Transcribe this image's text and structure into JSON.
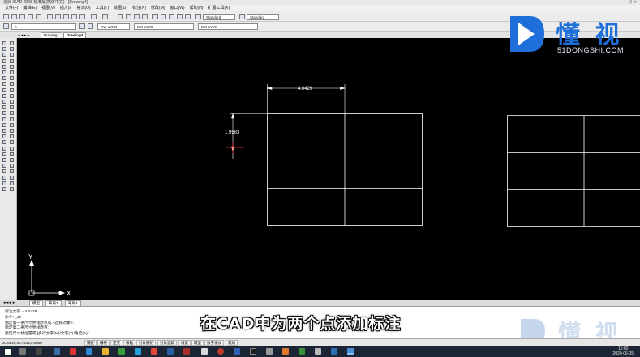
{
  "window": {
    "title": "浩辰 ICAD 2008 标准版(简体中文) - [Drawing4]",
    "controls": "—  ☐  ✕"
  },
  "menubar": {
    "items": [
      "文件(F)",
      "编辑(E)",
      "视图(V)",
      "插入(I)",
      "格式(O)",
      "工具(T)",
      "绘图(D)",
      "标注(N)",
      "修改(M)",
      "窗口(W)",
      "帮助(H)",
      "扩展工具(X)"
    ]
  },
  "toolbar": {
    "text_style": "Standard",
    "dim_style": "Standard",
    "layer": "0",
    "color": "BYLAYER",
    "linetype": "BYLAYER",
    "lineweight": "BYLAYER"
  },
  "tabs": {
    "drawings": [
      "Drawing1",
      "Drawing4"
    ],
    "layouts": [
      "模型",
      "布局1",
      "布局2"
    ]
  },
  "canvas": {
    "dimension_horizontal": "4.0429",
    "dimension_vertical": "1.9583",
    "ucs_x": "X",
    "ucs_y": "Y"
  },
  "command": {
    "lines": [
      "标注文字 = 4.0429",
      "命令: _dli",
      "指定第一条尺寸界线原点或 <选择对象>:",
      "指定第二条尺寸界线原点:"
    ],
    "prompt": "指定尺寸线位置或 [多行文字(M)/文字(T)/角度(A)]:"
  },
  "statusbar": {
    "coords": "20.6526,40.7213,0.0000",
    "toggles": [
      "捕捉",
      "栅格",
      "正交",
      "极轴",
      "对象捕捉",
      "对象追踪",
      "线宽",
      "模型",
      "数字化仪",
      "就绪"
    ]
  },
  "subtitle": "在CAD中为两个点添加标注",
  "watermark": {
    "brand": "懂 视",
    "url": "51DONGSHI.COM",
    "bottom_brand": "懂 视"
  },
  "taskbar": {
    "time": "15:02",
    "date": "2020-06-05"
  },
  "colors": {
    "canvas_bg": "#000000",
    "line": "#ffffff",
    "grip": "#ff3030",
    "brand_blue": "#1e6fd9"
  }
}
